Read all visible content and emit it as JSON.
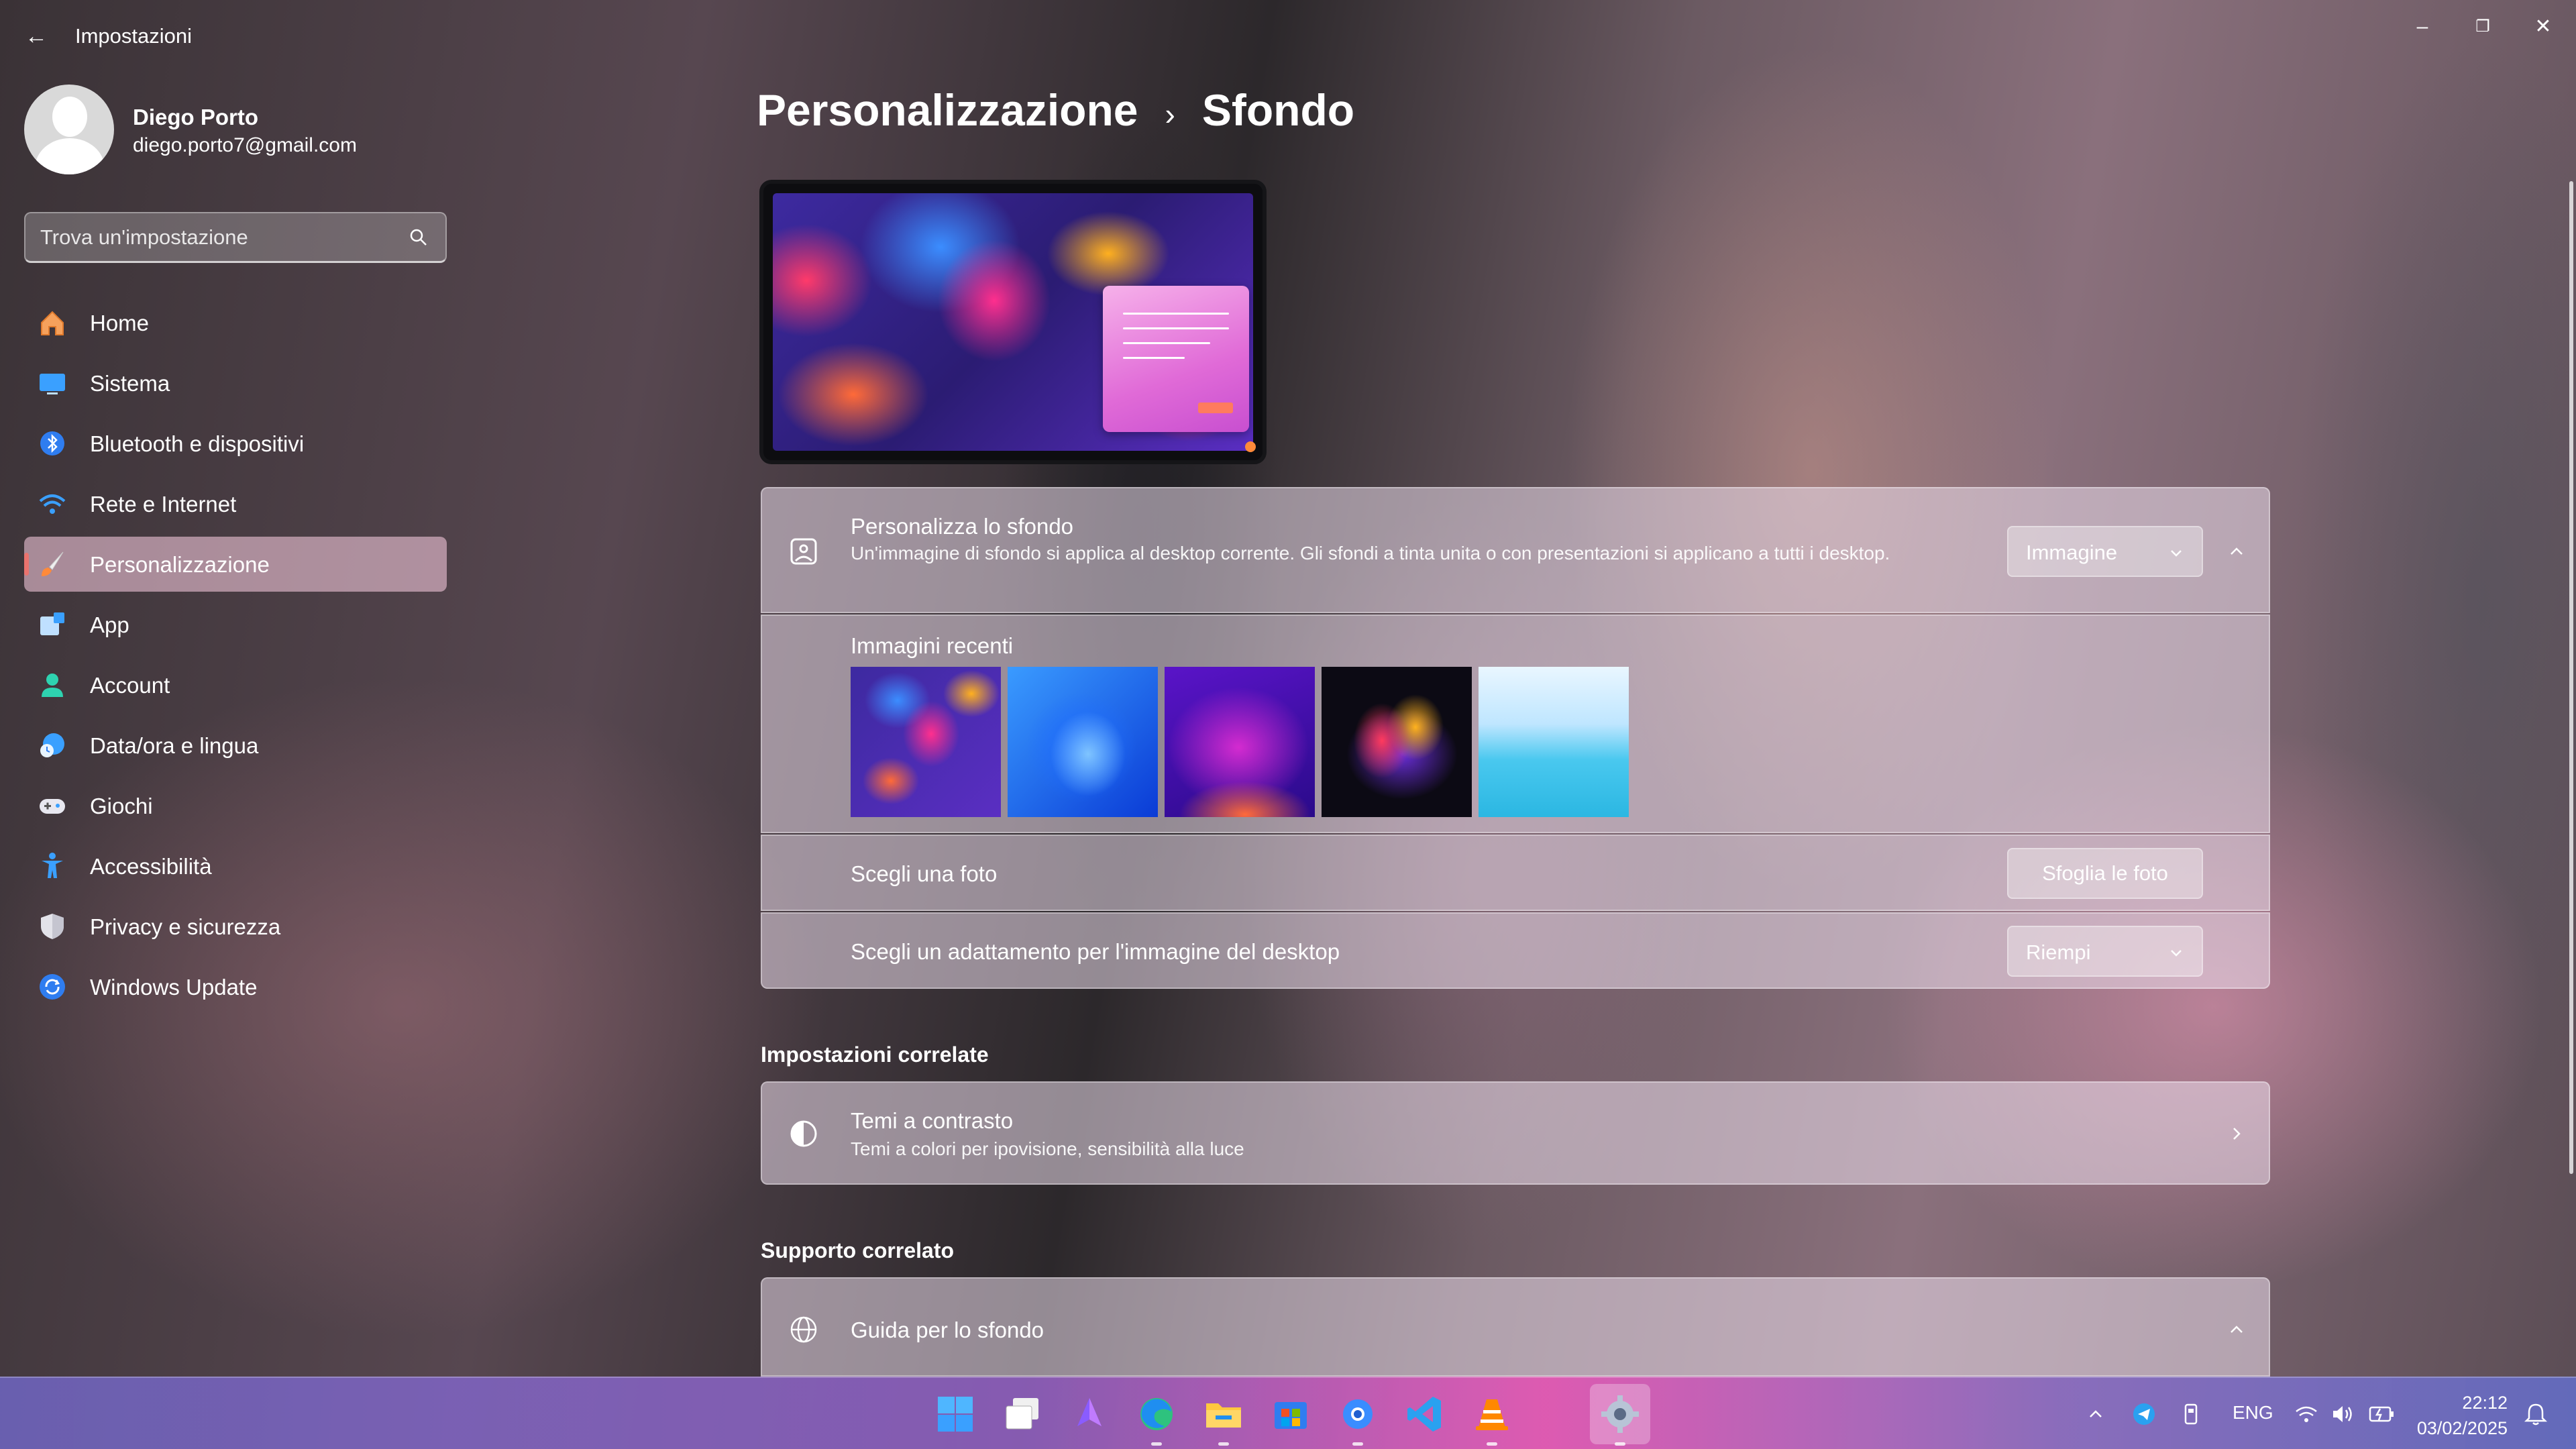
{
  "window": {
    "title": "Impostazioni",
    "back_icon": "←",
    "minimize_icon": "–",
    "restore_icon": "❐",
    "close_icon": "✕"
  },
  "profile": {
    "name": "Diego Porto",
    "email": "diego.porto7@gmail.com"
  },
  "search": {
    "placeholder": "Trova un'impostazione"
  },
  "nav": {
    "items": [
      {
        "label": "Home",
        "icon": "home-icon"
      },
      {
        "label": "Sistema",
        "icon": "system-icon"
      },
      {
        "label": "Bluetooth e dispositivi",
        "icon": "bluetooth-icon"
      },
      {
        "label": "Rete e Internet",
        "icon": "wifi-icon"
      },
      {
        "label": "Personalizzazione",
        "icon": "brush-icon",
        "active": true
      },
      {
        "label": "App",
        "icon": "apps-icon"
      },
      {
        "label": "Account",
        "icon": "account-icon"
      },
      {
        "label": "Data/ora e lingua",
        "icon": "globe-clock-icon"
      },
      {
        "label": "Giochi",
        "icon": "gamepad-icon"
      },
      {
        "label": "Accessibilità",
        "icon": "accessibility-icon"
      },
      {
        "label": "Privacy e sicurezza",
        "icon": "shield-icon"
      },
      {
        "label": "Windows Update",
        "icon": "update-icon"
      }
    ]
  },
  "breadcrumb": {
    "parent": "Personalizzazione",
    "separator": "›",
    "current": "Sfondo"
  },
  "background_section": {
    "title": "Personalizza lo sfondo",
    "description": "Un'immagine di sfondo si applica al desktop corrente. Gli sfondi a tinta unita o con presentazioni si applicano a tutti i desktop.",
    "type_value": "Immagine",
    "recent_title": "Immagini recenti",
    "choose_photo_label": "Scegli una foto",
    "browse_button": "Sfoglia le foto",
    "fit_label": "Scegli un adattamento per l'immagine del desktop",
    "fit_value": "Riempi"
  },
  "related_settings": {
    "title": "Impostazioni correlate",
    "contrast_title": "Temi a contrasto",
    "contrast_desc": "Temi a colori per ipovisione, sensibilità alla luce"
  },
  "related_support": {
    "title": "Supporto correlato",
    "guide_title": "Guida per lo sfondo"
  },
  "taskbar": {
    "language": "ENG",
    "time": "22:12",
    "date": "03/02/2025"
  },
  "colors": {
    "accent": "#e9736e",
    "nav_active_bg": "#f3c5d8"
  }
}
